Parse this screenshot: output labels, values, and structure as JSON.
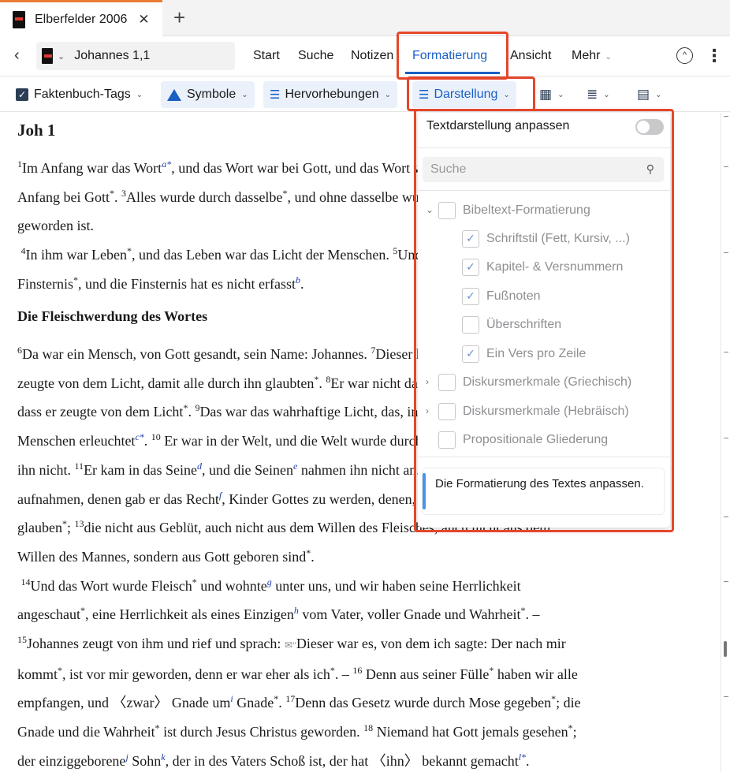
{
  "tabs": {
    "doc_tab_title": "Elberfelder 2006",
    "close_glyph": "✕",
    "new_tab_glyph": "+"
  },
  "nav": {
    "back_glyph": "‹",
    "reference": "Johannes 1,1",
    "menu": [
      "Start",
      "Suche",
      "Notizen",
      "Formatierung",
      "Ansicht",
      "Mehr"
    ],
    "active_menu": "Formatierung"
  },
  "toolbar": {
    "faktenbuch": "Faktenbuch-Tags",
    "symbole": "Symbole",
    "hervorhebungen": "Hervorhebungen",
    "darstellung": "Darstellung"
  },
  "panel": {
    "title": "Textdarstellung anpassen",
    "search_placeholder": "Suche",
    "group1": "Bibeltext-Formatierung",
    "sub": [
      {
        "label": "Schriftstil (Fett, Kursiv, ...)",
        "checked": true
      },
      {
        "label": "Kapitel- & Versnummern",
        "checked": true
      },
      {
        "label": "Fußnoten",
        "checked": true
      },
      {
        "label": "Überschriften",
        "checked": false
      },
      {
        "label": "Ein Vers pro Zeile",
        "checked": true
      }
    ],
    "group2": "Diskursmerkmale (Griechisch)",
    "group3": "Diskursmerkmale (Hebräisch)",
    "group4": "Propositionale Gliederung",
    "info": "Die Formatierung des Textes anpassen."
  },
  "text": {
    "chapter": "Joh 1",
    "heading": "Die Fleischwerdung des Wortes"
  },
  "colors": {
    "accent": "#1a5fc4",
    "highlight": "#e5462b",
    "tab_accent": "#e87b35"
  }
}
